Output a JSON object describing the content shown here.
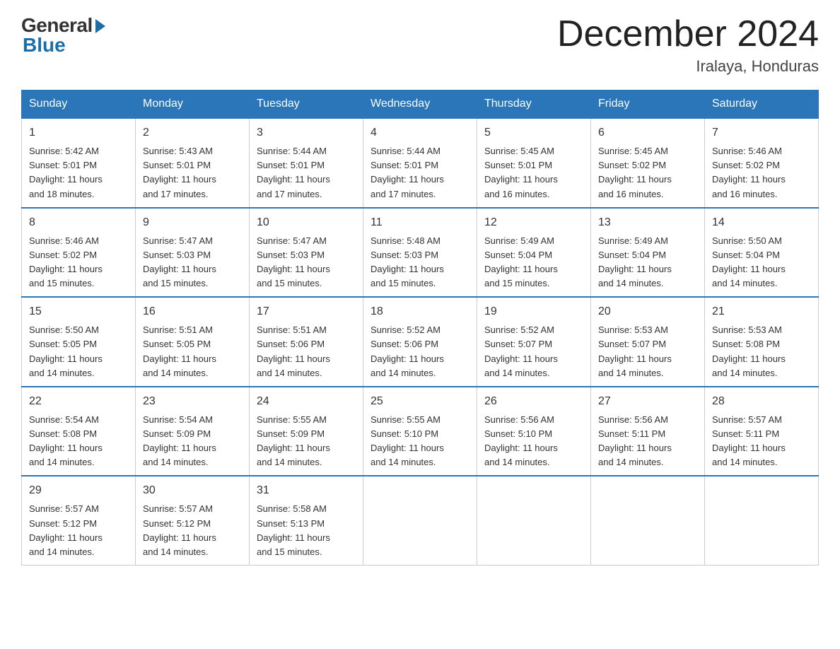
{
  "logo": {
    "general": "General",
    "blue": "Blue"
  },
  "header": {
    "month_title": "December 2024",
    "location": "Iralaya, Honduras"
  },
  "days_of_week": [
    "Sunday",
    "Monday",
    "Tuesday",
    "Wednesday",
    "Thursday",
    "Friday",
    "Saturday"
  ],
  "weeks": [
    [
      {
        "day": "1",
        "sunrise": "5:42 AM",
        "sunset": "5:01 PM",
        "daylight": "11 hours and 18 minutes."
      },
      {
        "day": "2",
        "sunrise": "5:43 AM",
        "sunset": "5:01 PM",
        "daylight": "11 hours and 17 minutes."
      },
      {
        "day": "3",
        "sunrise": "5:44 AM",
        "sunset": "5:01 PM",
        "daylight": "11 hours and 17 minutes."
      },
      {
        "day": "4",
        "sunrise": "5:44 AM",
        "sunset": "5:01 PM",
        "daylight": "11 hours and 17 minutes."
      },
      {
        "day": "5",
        "sunrise": "5:45 AM",
        "sunset": "5:01 PM",
        "daylight": "11 hours and 16 minutes."
      },
      {
        "day": "6",
        "sunrise": "5:45 AM",
        "sunset": "5:02 PM",
        "daylight": "11 hours and 16 minutes."
      },
      {
        "day": "7",
        "sunrise": "5:46 AM",
        "sunset": "5:02 PM",
        "daylight": "11 hours and 16 minutes."
      }
    ],
    [
      {
        "day": "8",
        "sunrise": "5:46 AM",
        "sunset": "5:02 PM",
        "daylight": "11 hours and 15 minutes."
      },
      {
        "day": "9",
        "sunrise": "5:47 AM",
        "sunset": "5:03 PM",
        "daylight": "11 hours and 15 minutes."
      },
      {
        "day": "10",
        "sunrise": "5:47 AM",
        "sunset": "5:03 PM",
        "daylight": "11 hours and 15 minutes."
      },
      {
        "day": "11",
        "sunrise": "5:48 AM",
        "sunset": "5:03 PM",
        "daylight": "11 hours and 15 minutes."
      },
      {
        "day": "12",
        "sunrise": "5:49 AM",
        "sunset": "5:04 PM",
        "daylight": "11 hours and 15 minutes."
      },
      {
        "day": "13",
        "sunrise": "5:49 AM",
        "sunset": "5:04 PM",
        "daylight": "11 hours and 14 minutes."
      },
      {
        "day": "14",
        "sunrise": "5:50 AM",
        "sunset": "5:04 PM",
        "daylight": "11 hours and 14 minutes."
      }
    ],
    [
      {
        "day": "15",
        "sunrise": "5:50 AM",
        "sunset": "5:05 PM",
        "daylight": "11 hours and 14 minutes."
      },
      {
        "day": "16",
        "sunrise": "5:51 AM",
        "sunset": "5:05 PM",
        "daylight": "11 hours and 14 minutes."
      },
      {
        "day": "17",
        "sunrise": "5:51 AM",
        "sunset": "5:06 PM",
        "daylight": "11 hours and 14 minutes."
      },
      {
        "day": "18",
        "sunrise": "5:52 AM",
        "sunset": "5:06 PM",
        "daylight": "11 hours and 14 minutes."
      },
      {
        "day": "19",
        "sunrise": "5:52 AM",
        "sunset": "5:07 PM",
        "daylight": "11 hours and 14 minutes."
      },
      {
        "day": "20",
        "sunrise": "5:53 AM",
        "sunset": "5:07 PM",
        "daylight": "11 hours and 14 minutes."
      },
      {
        "day": "21",
        "sunrise": "5:53 AM",
        "sunset": "5:08 PM",
        "daylight": "11 hours and 14 minutes."
      }
    ],
    [
      {
        "day": "22",
        "sunrise": "5:54 AM",
        "sunset": "5:08 PM",
        "daylight": "11 hours and 14 minutes."
      },
      {
        "day": "23",
        "sunrise": "5:54 AM",
        "sunset": "5:09 PM",
        "daylight": "11 hours and 14 minutes."
      },
      {
        "day": "24",
        "sunrise": "5:55 AM",
        "sunset": "5:09 PM",
        "daylight": "11 hours and 14 minutes."
      },
      {
        "day": "25",
        "sunrise": "5:55 AM",
        "sunset": "5:10 PM",
        "daylight": "11 hours and 14 minutes."
      },
      {
        "day": "26",
        "sunrise": "5:56 AM",
        "sunset": "5:10 PM",
        "daylight": "11 hours and 14 minutes."
      },
      {
        "day": "27",
        "sunrise": "5:56 AM",
        "sunset": "5:11 PM",
        "daylight": "11 hours and 14 minutes."
      },
      {
        "day": "28",
        "sunrise": "5:57 AM",
        "sunset": "5:11 PM",
        "daylight": "11 hours and 14 minutes."
      }
    ],
    [
      {
        "day": "29",
        "sunrise": "5:57 AM",
        "sunset": "5:12 PM",
        "daylight": "11 hours and 14 minutes."
      },
      {
        "day": "30",
        "sunrise": "5:57 AM",
        "sunset": "5:12 PM",
        "daylight": "11 hours and 14 minutes."
      },
      {
        "day": "31",
        "sunrise": "5:58 AM",
        "sunset": "5:13 PM",
        "daylight": "11 hours and 15 minutes."
      },
      null,
      null,
      null,
      null
    ]
  ],
  "labels": {
    "sunrise": "Sunrise:",
    "sunset": "Sunset:",
    "daylight": "Daylight:"
  }
}
